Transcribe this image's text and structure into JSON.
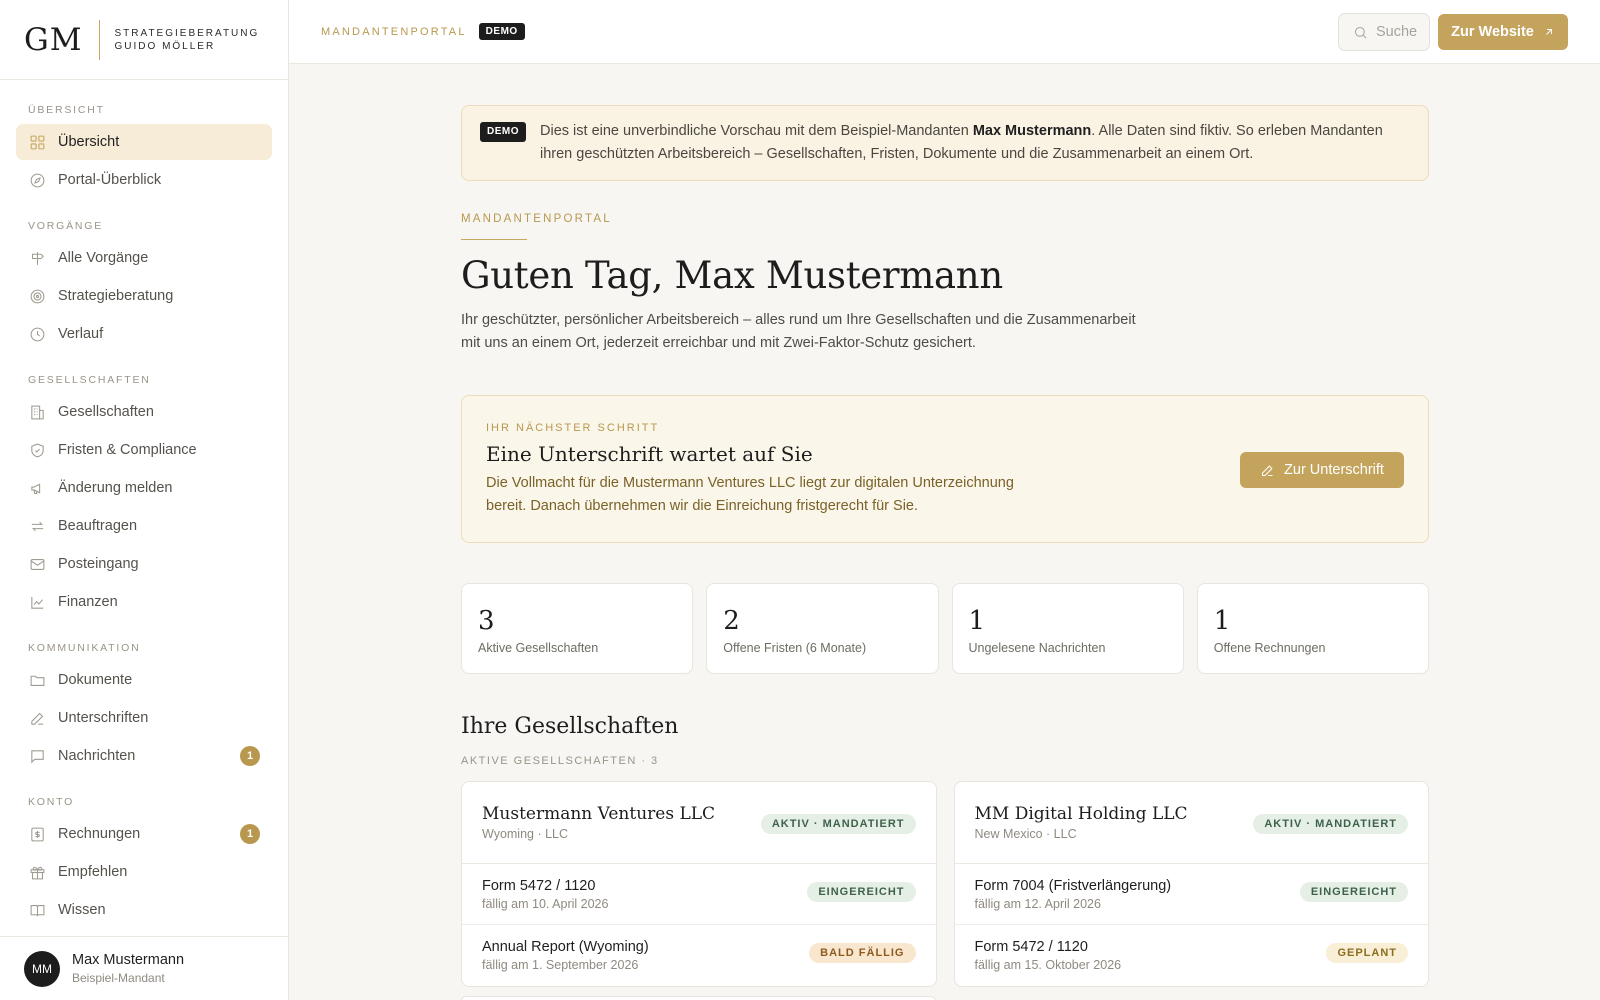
{
  "brand": {
    "mark": "GM",
    "line1": "STRATEGIEBERATUNG",
    "line2": "GUIDO MÖLLER"
  },
  "sidebar": {
    "sections": [
      {
        "title": "ÜBERSICHT",
        "items": [
          {
            "label": "Übersicht",
            "icon": "grid-icon",
            "active": true
          },
          {
            "label": "Portal-Überblick",
            "icon": "compass-icon"
          }
        ]
      },
      {
        "title": "VORGÄNGE",
        "items": [
          {
            "label": "Alle Vorgänge",
            "icon": "signpost-icon"
          },
          {
            "label": "Strategieberatung",
            "icon": "target-icon"
          },
          {
            "label": "Verlauf",
            "icon": "clock-icon"
          }
        ]
      },
      {
        "title": "GESELLSCHAFTEN",
        "items": [
          {
            "label": "Gesellschaften",
            "icon": "building-icon"
          },
          {
            "label": "Fristen & Compliance",
            "icon": "shield-icon"
          },
          {
            "label": "Änderung melden",
            "icon": "megaphone-icon"
          },
          {
            "label": "Beauftragen",
            "icon": "repeat-icon"
          },
          {
            "label": "Posteingang",
            "icon": "mail-icon"
          },
          {
            "label": "Finanzen",
            "icon": "chart-icon"
          }
        ]
      },
      {
        "title": "KOMMUNIKATION",
        "items": [
          {
            "label": "Dokumente",
            "icon": "folder-icon"
          },
          {
            "label": "Unterschriften",
            "icon": "pen-icon"
          },
          {
            "label": "Nachrichten",
            "icon": "message-icon",
            "badge": "1"
          }
        ]
      },
      {
        "title": "KONTO",
        "items": [
          {
            "label": "Rechnungen",
            "icon": "receipt-icon",
            "badge": "1"
          },
          {
            "label": "Empfehlen",
            "icon": "gift-icon"
          },
          {
            "label": "Wissen",
            "icon": "book-icon"
          }
        ]
      }
    ]
  },
  "user": {
    "initials": "MM",
    "name": "Max Mustermann",
    "role": "Beispiel-Mandant"
  },
  "topbar": {
    "label": "MANDANTENPORTAL",
    "demo_tag": "DEMO",
    "search_placeholder": "Suche",
    "website_button": "Zur Website"
  },
  "banner": {
    "tag": "DEMO",
    "text_before": "Dies ist eine unverbindliche Vorschau mit dem Beispiel-Mandanten ",
    "highlight": "Max Mustermann",
    "text_after": ". Alle Daten sind fiktiv. So erleben Mandanten ihren geschützten Arbeitsbereich – Gesellschaften, Fristen, Dokumente und die Zusammenarbeit an einem Ort."
  },
  "header": {
    "eyebrow": "MANDANTENPORTAL",
    "greeting": "Guten Tag, Max Mustermann",
    "intro": "Ihr geschützter, persönlicher Arbeitsbereich – alles rund um Ihre Gesellschaften und die Zusammenarbeit mit uns an einem Ort, jederzeit erreichbar und mit Zwei-Faktor-Schutz gesichert."
  },
  "next_step": {
    "eyebrow": "IHR NÄCHSTER SCHRITT",
    "title": "Eine Unterschrift wartet auf Sie",
    "text": "Die Vollmacht für die Mustermann Ventures LLC liegt zur digitalen Unterzeichnung bereit. Danach übernehmen wir die Einreichung fristgerecht für Sie.",
    "button": "Zur Unterschrift"
  },
  "stats": [
    {
      "value": "3",
      "label": "Aktive Gesellschaften"
    },
    {
      "value": "2",
      "label": "Offene Fristen (6 Monate)"
    },
    {
      "value": "1",
      "label": "Ungelesene Nachrichten"
    },
    {
      "value": "1",
      "label": "Offene Rechnungen"
    }
  ],
  "companies_section": {
    "title": "Ihre Gesellschaften",
    "sub_label": "AKTIVE GESELLSCHAFTEN · 3"
  },
  "companies": [
    {
      "name": "Mustermann Ventures LLC",
      "meta": "Wyoming · LLC",
      "status": "AKTIV · MANDATIERT",
      "forms": [
        {
          "title": "Form 5472 / 1120",
          "due": "fällig am 10. April 2026",
          "status": "EINGEREICHT",
          "tone": "green"
        },
        {
          "title": "Annual Report (Wyoming)",
          "due": "fällig am 1. September 2026",
          "status": "BALD FÄLLIG",
          "tone": "orange"
        }
      ]
    },
    {
      "name": "MM Digital Holding LLC",
      "meta": "New Mexico · LLC",
      "status": "AKTIV · MANDATIERT",
      "forms": [
        {
          "title": "Form 7004 (Fristverlängerung)",
          "due": "fällig am 12. April 2026",
          "status": "EINGEREICHT",
          "tone": "green"
        },
        {
          "title": "Form 5472 / 1120",
          "due": "fällig am 15. Oktober 2026",
          "status": "GEPLANT",
          "tone": "yellow"
        }
      ]
    }
  ],
  "colors": {
    "accent": "#c4a45c",
    "sidebar_active": "#f6ecd8",
    "banner_bg": "#faf3e4",
    "text_dark": "#1d1d1d"
  }
}
